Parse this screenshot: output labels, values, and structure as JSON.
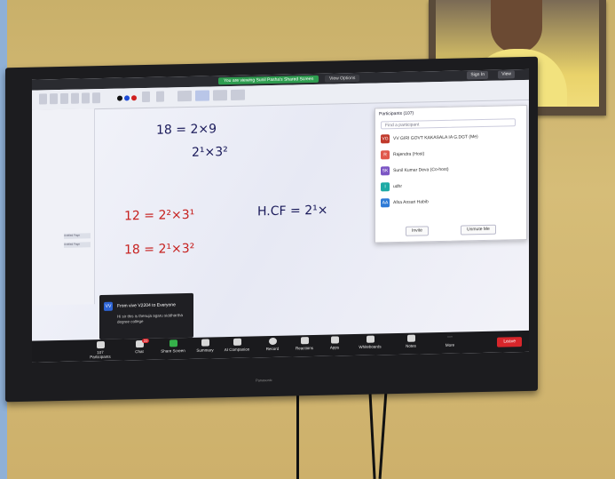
{
  "zoom": {
    "banner": "You are viewing Sunil Pasha's Shared Screen",
    "view_options": "View Options",
    "sign_in": "Sign In",
    "view": "View"
  },
  "whiteboard": {
    "side_label_1": "Untitled Page",
    "side_label_2": "Untitled Page",
    "line1": "18 =  2×9",
    "line2": "2¹×3²",
    "line3": "12 =  2²×3¹",
    "line4": "18 =  2¹×3²",
    "line5": "H.CF =  2¹×"
  },
  "participants": {
    "title": "Participants (107)",
    "search_placeholder": "Find a participant",
    "rows": [
      {
        "initials": "VG",
        "name": "VV GIRI GOVT KAKASALA IA G.DGT (Me)",
        "color": "#c0392b"
      },
      {
        "initials": "R",
        "name": "Rajendra (Host)",
        "color": "#e0584b"
      },
      {
        "initials": "SK",
        "name": "Sunil Kumar Deva (Co-host)",
        "color": "#7b55c4"
      },
      {
        "initials": "l",
        "name": "udhr",
        "color": "#1eaaa5"
      },
      {
        "initials": "AA",
        "name": "Afsa Ansari Habib",
        "color": "#2d7ad6"
      }
    ],
    "invite": "Invite",
    "unmute": "Unmute Me"
  },
  "chat_toast": {
    "initials": "VV",
    "header": "From vive V2204 to Everyone",
    "message": "Hi sir this is thenuja agaru siddhartha degree college"
  },
  "toolbar": {
    "participants": "Participants",
    "participants_count": "107",
    "chat": "Chat",
    "chat_badge": "22",
    "share_screen": "Share Screen",
    "summary": "Summary",
    "ai_companion": "AI Companion",
    "record": "Record",
    "reactions": "Reactions",
    "apps": "Apps",
    "whiteboards": "Whiteboards",
    "notes": "Notes",
    "more": "More",
    "leave": "Leave"
  },
  "tv_brand": "Panasonic"
}
